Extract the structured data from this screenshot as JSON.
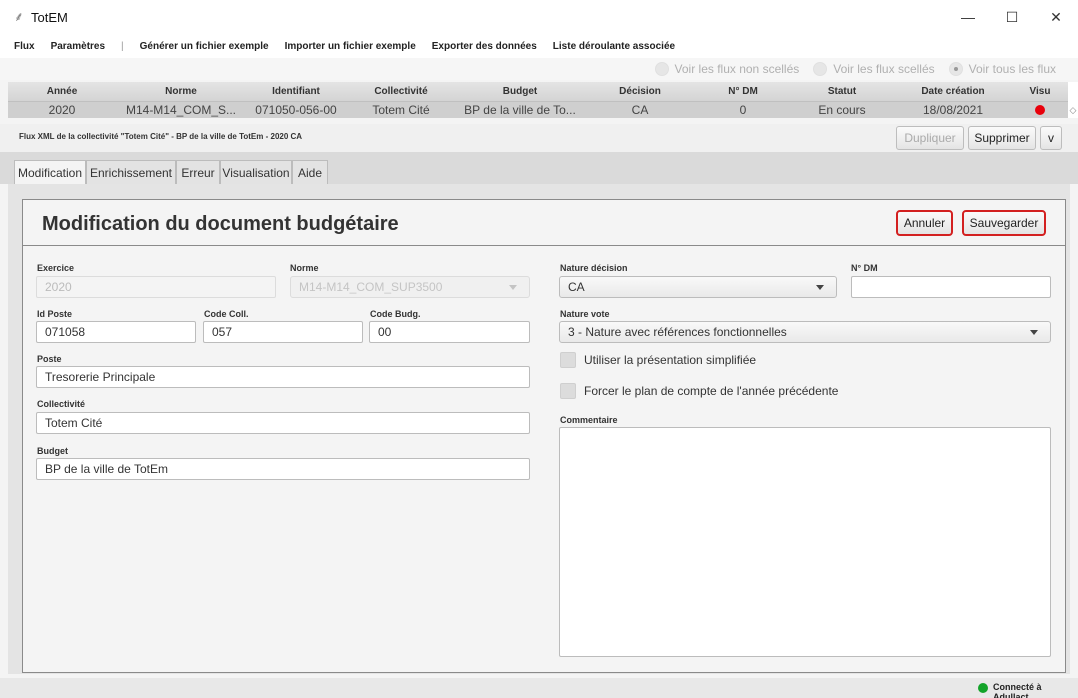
{
  "window": {
    "title": "TotEM",
    "minimize": "—",
    "maximize": "☐",
    "close": "✕"
  },
  "menu": {
    "flux": "Flux",
    "parametres": "Paramètres",
    "separator": "|",
    "generer": "Générer un fichier exemple",
    "importer": "Importer un fichier exemple",
    "exporter": "Exporter des données",
    "liste": "Liste déroulante associée"
  },
  "filters": {
    "non_scelles": "Voir les flux non scellés",
    "scelles": "Voir les flux scellés",
    "tous": "Voir tous les flux",
    "selected": "tous"
  },
  "grid": {
    "columns": [
      "Année",
      "Norme",
      "Identifiant",
      "Collectivité",
      "Budget",
      "Décision",
      "N° DM",
      "Statut",
      "Date création",
      "Visu"
    ],
    "row": [
      "2020",
      "M14-M14_COM_S...",
      "071050-056-00",
      "Totem Cité",
      "BP de la ville de To...",
      "CA",
      "0",
      "En cours",
      "18/08/2021",
      ""
    ],
    "visu_color": "#e8000b"
  },
  "info": {
    "text": "Flux XML de la collectivité \"Totem Cité\" - BP de la ville de TotEm - 2020 CA",
    "dupliquer": "Dupliquer",
    "supprimer": "Supprimer",
    "v": "v"
  },
  "tabs": [
    "Modification",
    "Enrichissement",
    "Erreur",
    "Visualisation",
    "Aide"
  ],
  "form": {
    "title": "Modification du document budgétaire",
    "annuler": "Annuler",
    "sauvegarder": "Sauvegarder",
    "exercice_label": "Exercice",
    "exercice_value": "2020",
    "norme_label": "Norme",
    "norme_value": "M14-M14_COM_SUP3500",
    "id_poste_label": "Id Poste",
    "id_poste_value": "071058",
    "code_coll_label": "Code Coll.",
    "code_coll_value": "057",
    "code_budg_label": "Code Budg.",
    "code_budg_value": "00",
    "poste_label": "Poste",
    "poste_value": "Tresorerie Principale",
    "collectivite_label": "Collectivité",
    "collectivite_value": "Totem Cité",
    "budget_label": "Budget",
    "budget_value": "BP de la ville de TotEm",
    "nature_decision_label": "Nature décision",
    "nature_decision_value": "CA",
    "ndm_label": "N° DM",
    "ndm_value": "",
    "nature_vote_label": "Nature vote",
    "nature_vote_value": "3 - Nature avec références fonctionnelles",
    "simplifiee_label": "Utiliser la présentation simplifiée",
    "forcer_label": "Forcer le plan de compte de l'année précédente",
    "commentaire_label": "Commentaire"
  },
  "status": {
    "text": "Connecté à Adullact",
    "color": "#13a329"
  }
}
